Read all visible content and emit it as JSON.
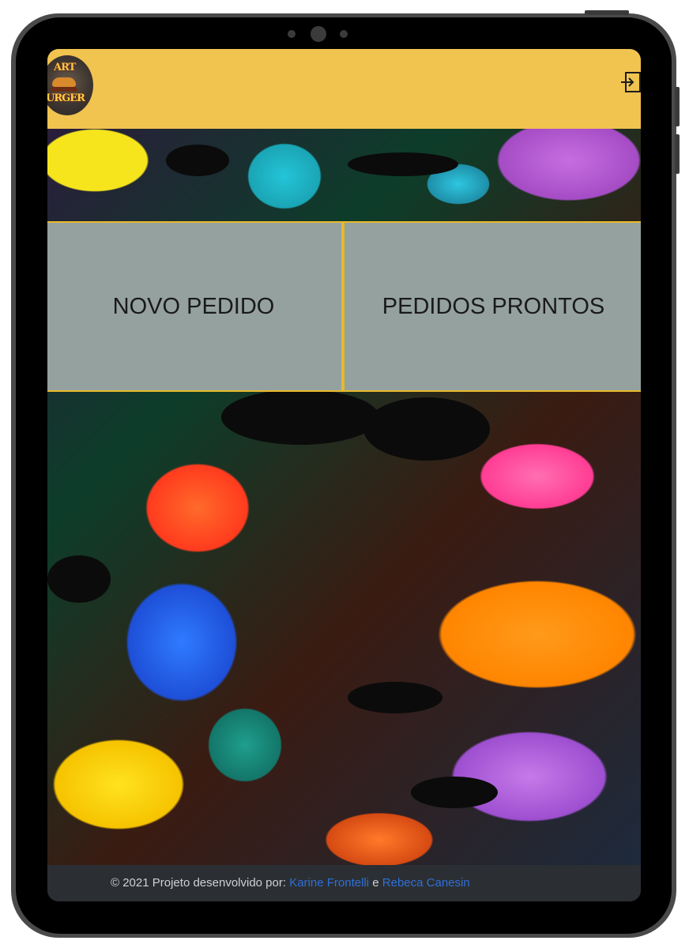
{
  "header": {
    "logo": {
      "line1": "ART",
      "line2": "URGER",
      "icon": "art-burger-logo"
    },
    "logout_icon": "logout-icon",
    "color": "#f1c34f"
  },
  "actions": {
    "new_order": "NOVO PEDIDO",
    "ready_orders": "PEDIDOS PRONTOS",
    "button_color": "#95a19f",
    "border_color": "#e8b92a"
  },
  "footer": {
    "prefix": "© 2021 Projeto desenvolvido por:",
    "author1": "Karine Frontelli",
    "connector": "e",
    "author2": "Rebeca Canesin"
  }
}
